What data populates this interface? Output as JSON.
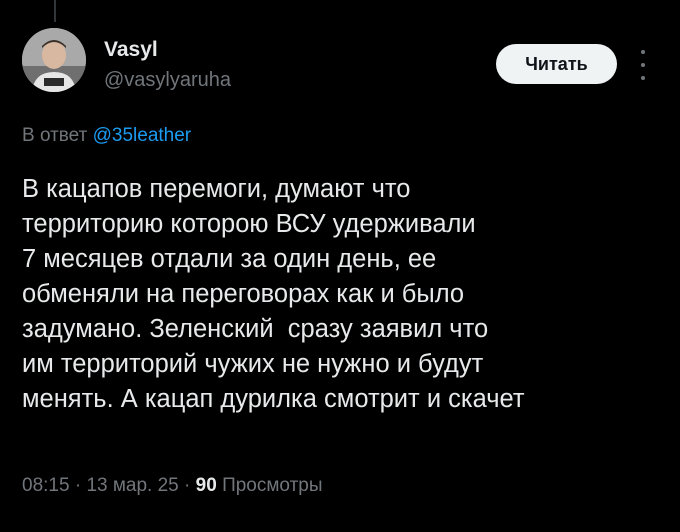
{
  "author": {
    "name": "Vasyl",
    "handle": "@vasylyaruha"
  },
  "follow_button_label": "Читать",
  "reply": {
    "prefix": "В ответ",
    "handle": "@35leather"
  },
  "tweet": {
    "lines": [
      "В кацапов перемоги, думают что",
      "территорию которою ВСУ удерживали",
      "7 месяцев отдали за один день, ее",
      "обменяли на переговорах как и было",
      "задумано. Зеленский  сразу заявил что",
      "им территорий чужих не нужно и будут",
      "менять. А кацап дурилка смотрит и скачет"
    ]
  },
  "meta": {
    "time": "08:15",
    "separator": "·",
    "date": "13 мар. 25",
    "views_count": "90",
    "views_label": "Просмотры"
  },
  "colors": {
    "background": "#000000",
    "text_primary": "#e7e9ea",
    "text_secondary": "#71767b",
    "link": "#1d9bf0",
    "button_bg": "#eff3f4",
    "button_text": "#0f1419"
  },
  "icons": {
    "more": "more-vertical-icon"
  }
}
